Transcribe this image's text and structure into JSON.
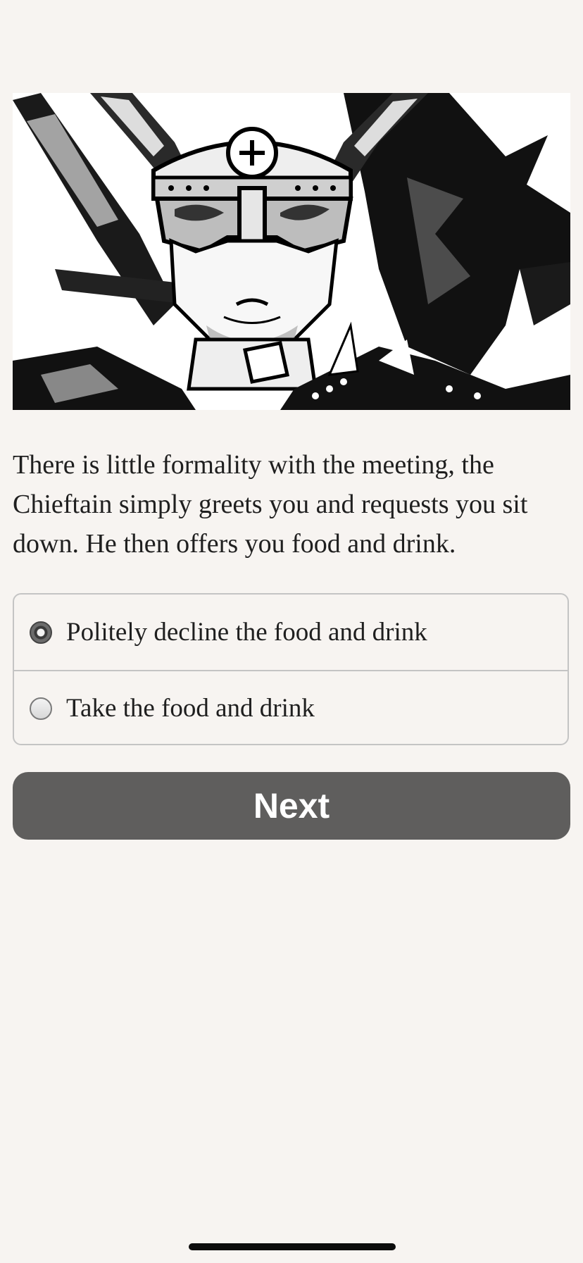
{
  "story": {
    "illustration_subject": "horned-helmet-chieftain-illustration",
    "text": "There is little formality with the meeting, the Chieftain simply greets you and requests you sit down. He then offers you food and drink."
  },
  "choices": [
    {
      "label": "Politely decline the food and drink",
      "selected": true
    },
    {
      "label": "Take the food and drink",
      "selected": false
    }
  ],
  "actions": {
    "next_label": "Next"
  },
  "colors": {
    "background": "#f7f4f1",
    "button": "#5f5e5d",
    "button_text": "#ffffff",
    "text": "#1f1f1f",
    "border": "#c4c4c4"
  }
}
